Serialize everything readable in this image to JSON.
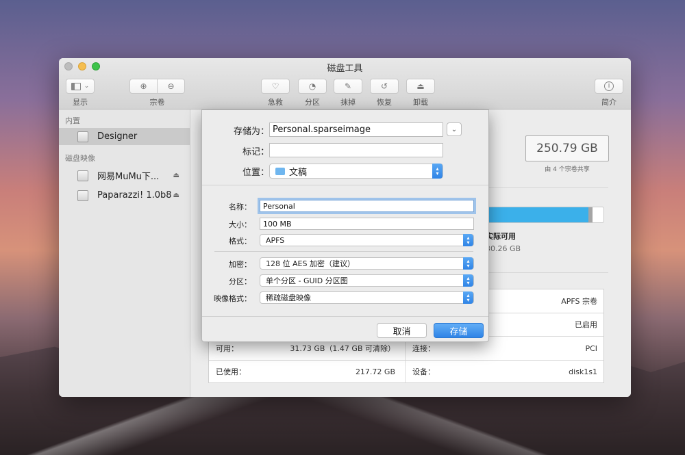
{
  "window": {
    "title": "磁盘工具"
  },
  "toolbar": {
    "show_label": "显示",
    "volume_label": "宗卷",
    "firstaid_label": "急救",
    "partition_label": "分区",
    "erase_label": "抹掉",
    "restore_label": "恢复",
    "unmount_label": "卸载",
    "info_label": "简介"
  },
  "sidebar": {
    "internal_section": "内置",
    "internal_items": [
      {
        "label": "Designer"
      }
    ],
    "images_section": "磁盘映像",
    "image_items": [
      {
        "label": "网易MuMu下..."
      },
      {
        "label": "Paparazzi! 1.0b8"
      }
    ]
  },
  "main": {
    "capacity": "250.79 GB",
    "capacity_note": "由 4 个宗卷共享",
    "legend_label": "实际可用",
    "legend_value": "30.26 GB",
    "usage": {
      "used_fraction": 0.88,
      "other_fraction": 0.03
    },
    "info_left": [
      {
        "k": "可用：",
        "v": "31.73 GB（1.47 GB 可清除）"
      },
      {
        "k": "已使用：",
        "v": "217.72 GB"
      }
    ],
    "info_right": [
      {
        "k": "",
        "v": "APFS 宗卷"
      },
      {
        "k": "",
        "v": "已启用"
      },
      {
        "k": "连接：",
        "v": "PCI"
      },
      {
        "k": "设备：",
        "v": "disk1s1"
      }
    ]
  },
  "dialog": {
    "save_as_label": "存储为：",
    "save_as_value": "Personal.sparseimage",
    "tags_label": "标记：",
    "tags_value": "",
    "location_label": "位置：",
    "location_value": "文稿",
    "name_label": "名称：",
    "name_value": "Personal",
    "size_label": "大小：",
    "size_value": "100 MB",
    "format_label": "格式：",
    "format_value": "APFS",
    "encryption_label": "加密：",
    "encryption_value": "128 位 AES 加密（建议）",
    "partition_label": "分区：",
    "partition_value": "单个分区 - GUID 分区图",
    "image_format_label": "映像格式：",
    "image_format_value": "稀疏磁盘映像",
    "cancel_label": "取消",
    "save_label": "存储"
  }
}
